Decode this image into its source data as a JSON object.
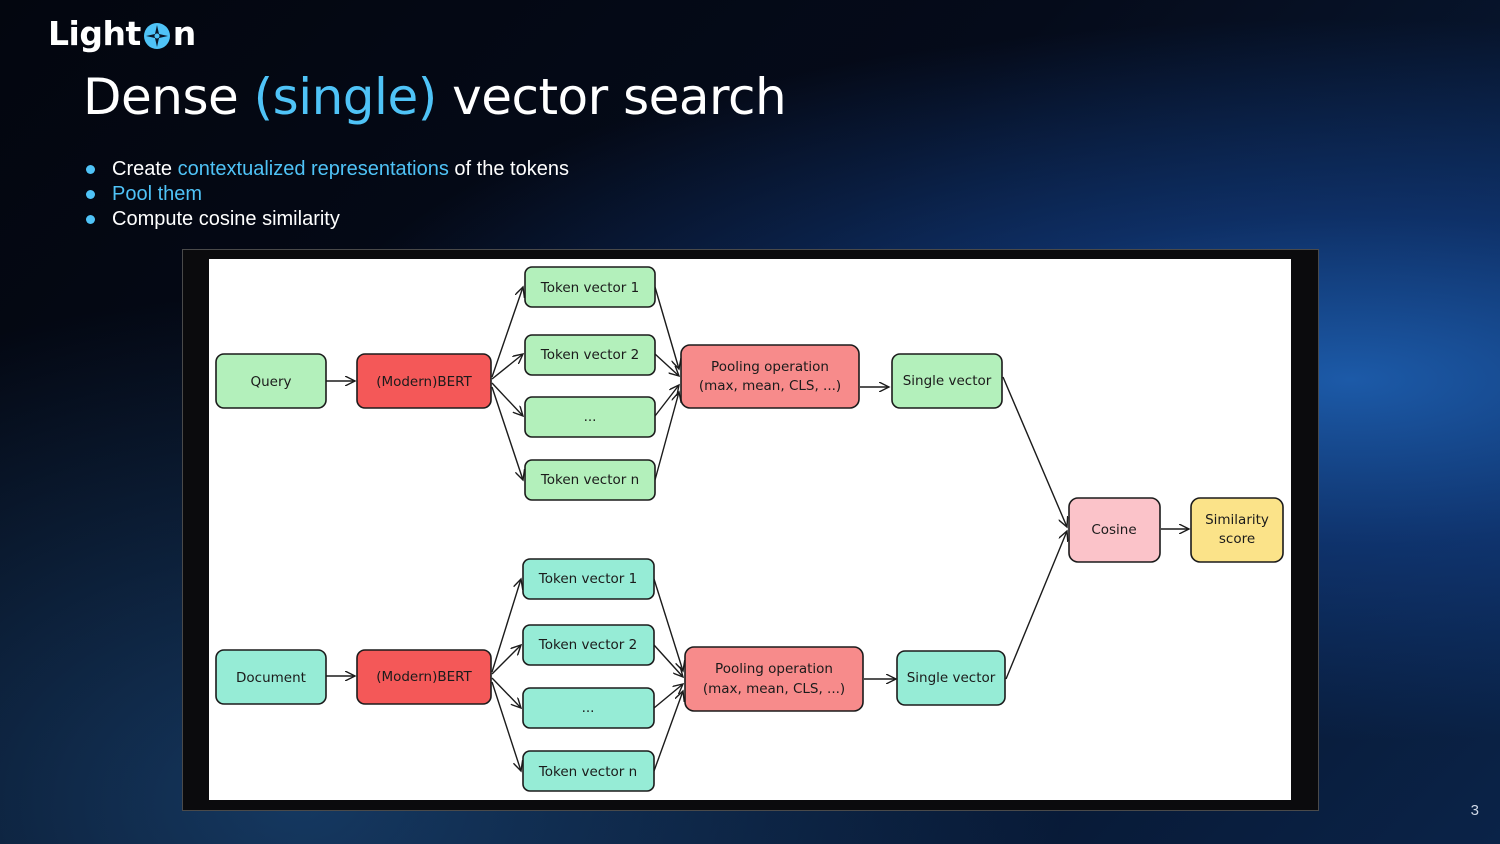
{
  "brand": {
    "logo_text_left": "Light",
    "logo_text_right": "n"
  },
  "slide": {
    "title_part1": "Dense ",
    "title_highlight": "(single)",
    "title_part2": " vector search",
    "page_number": "3"
  },
  "bullets": [
    {
      "pre": "Create ",
      "highlight": "contextualized representations",
      "post": " of the tokens"
    },
    {
      "pre": "",
      "highlight": "Pool them",
      "post": ""
    },
    {
      "pre": "Compute cosine similarity",
      "highlight": "",
      "post": ""
    }
  ],
  "colors": {
    "accent": "#4fc3f7",
    "query_green": "#b3f0bb",
    "document_teal": "#96ecd6",
    "bert_red": "#f45858",
    "pooling_red": "#f78b8b",
    "cosine_pink": "#fbc3c9",
    "score_yellow": "#fbe389"
  },
  "diagram": {
    "query": {
      "input": "Query",
      "encoder": "(Modern)BERT",
      "tokens": [
        "Token vector 1",
        "Token vector 2",
        "...",
        "Token vector n"
      ],
      "pooling_line1": "Pooling operation",
      "pooling_line2": "(max, mean, CLS, ...)",
      "output": "Single vector"
    },
    "document": {
      "input": "Document",
      "encoder": "(Modern)BERT",
      "tokens": [
        "Token vector 1",
        "Token vector 2",
        "...",
        "Token vector n"
      ],
      "pooling_line1": "Pooling operation",
      "pooling_line2": "(max, mean, CLS, ...)",
      "output": "Single vector"
    },
    "cosine": "Cosine",
    "score_line1": "Similarity",
    "score_line2": "score"
  }
}
